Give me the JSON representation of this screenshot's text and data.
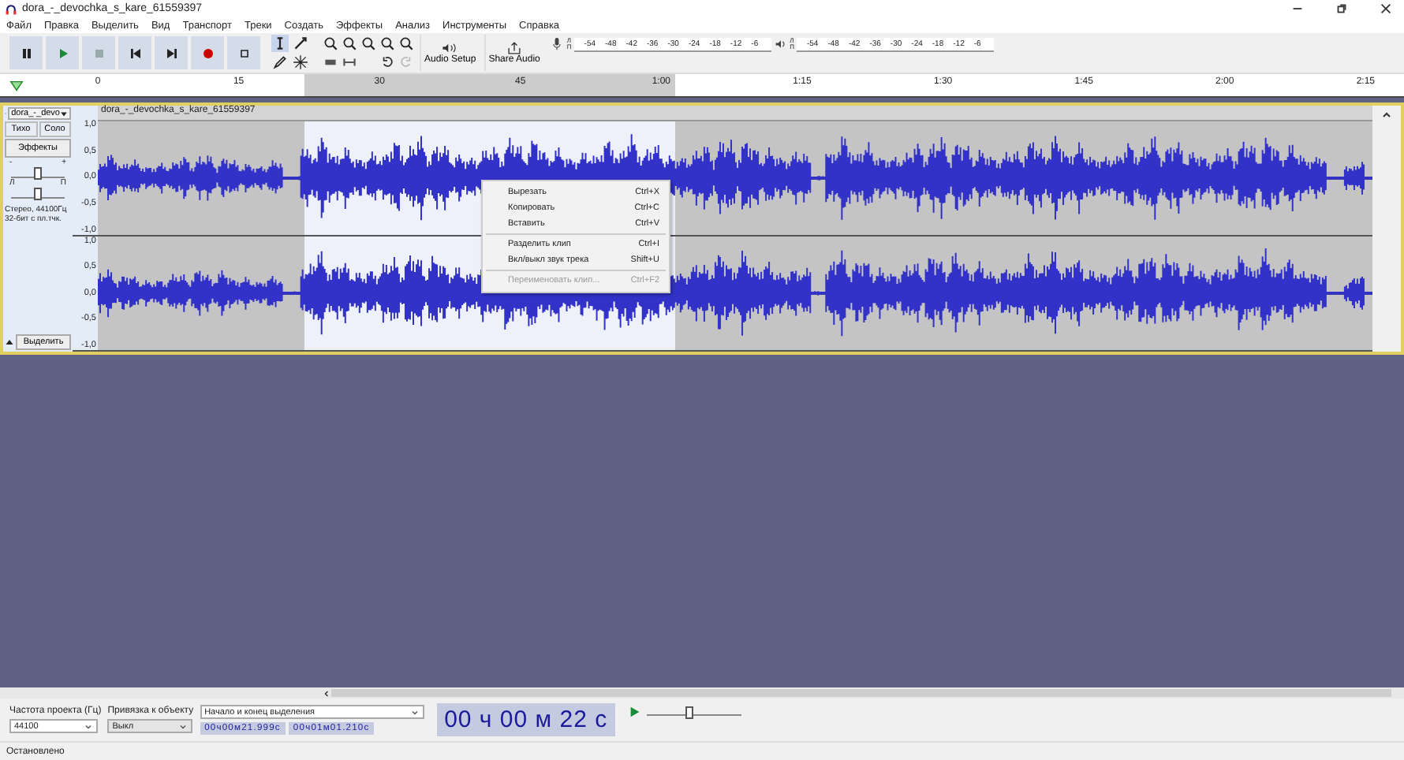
{
  "window": {
    "title": "dora_-_devochka_s_kare_61559397"
  },
  "menu": [
    "Файл",
    "Правка",
    "Выделить",
    "Вид",
    "Транспорт",
    "Треки",
    "Создать",
    "Эффекты",
    "Анализ",
    "Инструменты",
    "Справка"
  ],
  "toolbar_buttons": [
    "Audio Setup",
    "Share Audio"
  ],
  "recording_meter": {
    "channels": [
      "Л",
      "П"
    ],
    "ticks": [
      "-54",
      "-48",
      "-42",
      "-36",
      "-30",
      "-24",
      "-18",
      "-12",
      "-6"
    ]
  },
  "playback_meter": {
    "channels": [
      "Л",
      "П"
    ],
    "ticks": [
      "-54",
      "-48",
      "-42",
      "-36",
      "-30",
      "-24",
      "-18",
      "-12",
      "-6"
    ]
  },
  "ruler": {
    "ticks": [
      "0",
      "15",
      "30",
      "45",
      "1:00",
      "1:15",
      "1:30",
      "1:45",
      "2:00",
      "2:15"
    ]
  },
  "track": {
    "name": "dora_-_devo",
    "selected": true,
    "buttons": [
      {
        "label": "Тихо",
        "selected": false
      },
      {
        "label": "Соло",
        "selected": false
      }
    ],
    "effects_button": "Эффекты",
    "gain": {
      "min": "-",
      "max": "+",
      "level": 0.5
    },
    "pan": {
      "left": "Л",
      "right": "П",
      "level": 0.5
    },
    "info_lines": [
      "Стерео, 44100Гц",
      "32-бит с пл.тчк."
    ],
    "select_button": "Выделить",
    "clip_title": "dora_-_devochka_s_kare_61559397",
    "channels": [
      {
        "scale": [
          "1,0",
          "0,5",
          "0,0",
          "-0,5",
          "-1,0"
        ]
      },
      {
        "scale": [
          "1,0",
          "0,5",
          "0,0",
          "-0,5",
          "-1,0"
        ]
      }
    ]
  },
  "context_menu": {
    "items": [
      {
        "label": "Вырезать",
        "shortcut": "Ctrl+X",
        "disabled": false,
        "separator_before": false
      },
      {
        "label": "Копировать",
        "shortcut": "Ctrl+C",
        "disabled": false,
        "separator_before": false
      },
      {
        "label": "Вставить",
        "shortcut": "Ctrl+V",
        "disabled": false,
        "separator_before": false
      },
      {
        "label": "Разделить клип",
        "shortcut": "Ctrl+I",
        "disabled": false,
        "separator_before": true
      },
      {
        "label": "Вкл/выкл звук трека",
        "shortcut": "Shift+U",
        "disabled": false,
        "separator_before": false
      },
      {
        "label": "Переименовать клип...",
        "shortcut": "Ctrl+F2",
        "disabled": true,
        "separator_before": true
      }
    ]
  },
  "selection_toolbar": {
    "rate_label": "Частота проекта (Гц)",
    "rate_value": "44100",
    "snap_label": "Привязка к объекту",
    "snap_value": "Выкл",
    "selection_mode": "Начало и конец выделения",
    "start_time": "00ч00м21.999с",
    "end_time": "00ч01м01.210с",
    "position": "00 ч 00 м 22 с",
    "speed": {
      "level": 0.45
    }
  },
  "status_bar": "Остановлено"
}
